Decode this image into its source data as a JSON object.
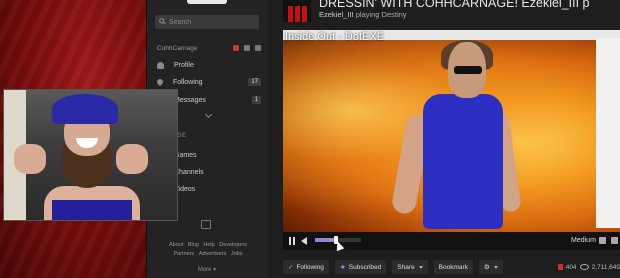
{
  "sidebar": {
    "search_placeholder": "Search",
    "username": "CohhCarnage",
    "nav": [
      {
        "label": "Profile",
        "icon": "person-icon",
        "count": ""
      },
      {
        "label": "Following",
        "icon": "heart-icon",
        "count": "17"
      },
      {
        "label": "Messages",
        "icon": "mail-icon",
        "count": "1"
      }
    ],
    "browse_label": "BROWSE",
    "browse": [
      {
        "label": "Games",
        "icon": "gamepad-icon"
      },
      {
        "label": "Channels",
        "icon": "video-camera-icon"
      },
      {
        "label": "Videos",
        "icon": "play-icon"
      }
    ],
    "footer_links_row1": [
      "About",
      "Blog",
      "Help",
      "Developers"
    ],
    "footer_links_row2": [
      "Partners",
      "Advertisers",
      "Jobs"
    ],
    "more": "More ▾"
  },
  "stream": {
    "title": "DRESSIN' WITH COHHCARNAGE! Ezekiel_III p",
    "user": "Ezekiel_III",
    "playing_text": "playing Destiny",
    "overlay_title": "Inside Out - DotEXE"
  },
  "player": {
    "quality": "Medium",
    "volume_level": 0.45
  },
  "actions": {
    "follow": "Following",
    "subscribe": "Subscribed",
    "share": "Share",
    "bookmark": "Bookmark",
    "viewers": "404",
    "views": "2,711,649"
  },
  "colors": {
    "accent": "#9a85d8",
    "live_red": "#d12b2b"
  }
}
